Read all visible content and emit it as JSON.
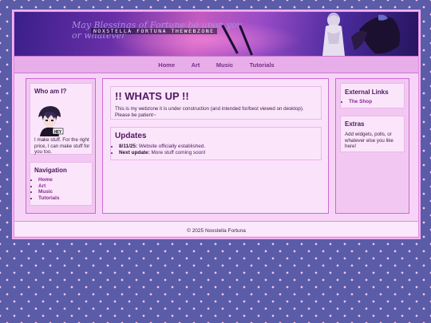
{
  "banner": {
    "tagline_line1": "May Blessings of Fortune be upon you",
    "tagline_line2": "or whatever",
    "brand": "NOXSTELLA FORTUNA THEWEBZONE"
  },
  "nav": {
    "items": [
      "Home",
      "Art",
      "Music",
      "Tutorials"
    ]
  },
  "left": {
    "about": {
      "title": "Who am I?",
      "avatar_caption": "HEY",
      "text": "I make stuff. For the right price, I can make stuff for you too."
    },
    "navigation": {
      "title": "Navigation",
      "links": [
        "Home",
        "Art",
        "Music",
        "Tutorials"
      ]
    }
  },
  "main": {
    "whatsup": {
      "title": "!! WHATS UP !!",
      "text": "This is my webzone it is under construction (and intended for/best viewed on desktop). Please be patient~"
    },
    "updates": {
      "title": "Updates",
      "items": [
        {
          "label": "8/11/25:",
          "text": "Website officially established."
        },
        {
          "label": "Next update:",
          "text": "More stuff coming soon!"
        }
      ]
    }
  },
  "right": {
    "external": {
      "title": "External Links",
      "links": [
        "The Shop"
      ]
    },
    "extras": {
      "title": "Extras",
      "text": "Add widgets, polls, or whatever else you like here!"
    }
  },
  "footer": {
    "text": "© 2025 Noxstella Fortuna"
  },
  "colors": {
    "page_bg": "#5a5ca8",
    "panel_bg": "#f7d4f7",
    "nav_bg": "#e7aee9",
    "link": "#8a2b96",
    "heading": "#4d1860"
  }
}
